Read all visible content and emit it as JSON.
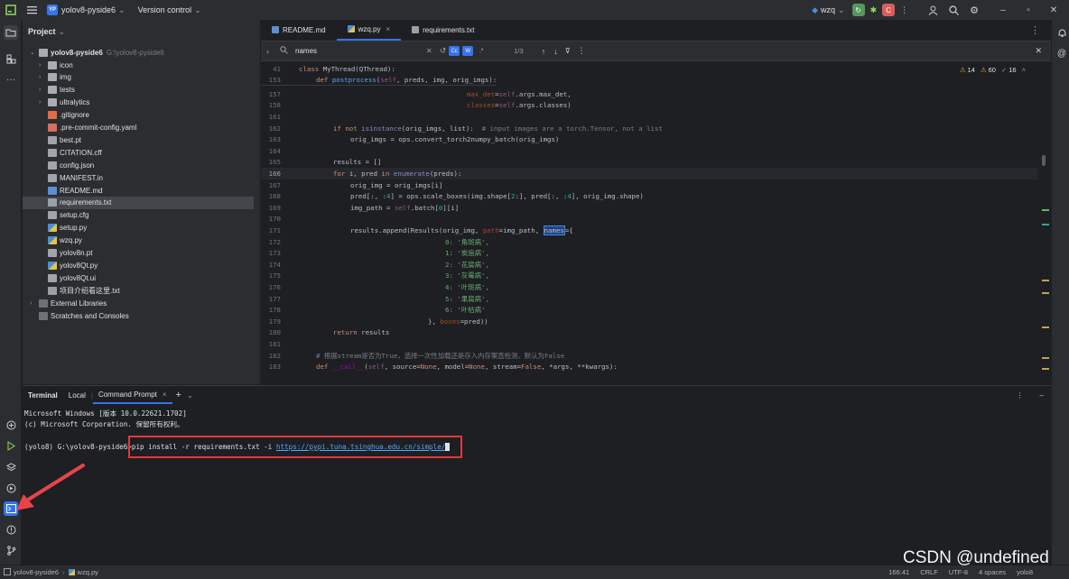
{
  "titlebar": {
    "project_badge": "YP",
    "project_name": "yolov8-pyside6",
    "vcs_label": "Version control",
    "run_config": "wzq",
    "colors": {
      "accent": "#3574f0",
      "run_green": "#57965c",
      "stop_red": "#db5c5c"
    }
  },
  "project_panel": {
    "title": "Project",
    "root_name": "yolov8-pyside6",
    "root_path": "G:\\yolov8-pyside6",
    "items": [
      {
        "label": "icon",
        "kind": "folder"
      },
      {
        "label": "img",
        "kind": "folder"
      },
      {
        "label": "tests",
        "kind": "folder"
      },
      {
        "label": "ultralytics",
        "kind": "folder"
      },
      {
        "label": ".gitignore",
        "kind": "git"
      },
      {
        "label": ".pre-commit-config.yaml",
        "kind": "yaml"
      },
      {
        "label": "best.pt",
        "kind": "file"
      },
      {
        "label": "CITATION.cff",
        "kind": "file"
      },
      {
        "label": "config.json",
        "kind": "file"
      },
      {
        "label": "MANIFEST.in",
        "kind": "file"
      },
      {
        "label": "README.md",
        "kind": "md"
      },
      {
        "label": "requirements.txt",
        "kind": "txt"
      },
      {
        "label": "setup.cfg",
        "kind": "file"
      },
      {
        "label": "setup.py",
        "kind": "py"
      },
      {
        "label": "wzq.py",
        "kind": "py"
      },
      {
        "label": "yolov8n.pt",
        "kind": "file"
      },
      {
        "label": "yolov8Qt.py",
        "kind": "py"
      },
      {
        "label": "yolov8Qt.ui",
        "kind": "file"
      },
      {
        "label": "项目介绍看这里.txt",
        "kind": "txt"
      }
    ],
    "external_libraries": "External Libraries",
    "scratches": "Scratches and Consoles"
  },
  "editor": {
    "tabs": [
      "README.md",
      "wzq.py",
      "requirements.txt"
    ],
    "active_tab": "wzq.py",
    "find": {
      "query": "names",
      "match_count": "1/3",
      "case_label": "Cc",
      "word_label": "W",
      "regex_label": ".*"
    },
    "inspections": {
      "warnings": "14",
      "weak_warnings": "60",
      "typos": "16"
    },
    "breadcrumb_class": "class MyThread(QThread):",
    "breadcrumb_def": "def postprocess(self, preds, img, orig_imgs):",
    "lines": [
      {
        "n": "41",
        "text": "class MyThread(QThread):"
      },
      {
        "n": "153",
        "text": "def postprocess(self, preds, img, orig_imgs):"
      },
      {
        "n": "157",
        "text": "max_det=self.args.max_det,"
      },
      {
        "n": "158",
        "text": "classes=self.args.classes)"
      },
      {
        "n": "161",
        "text": ""
      },
      {
        "n": "162",
        "text": "if not isinstance(orig_imgs, list):",
        "comment": "# input images are a torch.Tensor, not a list"
      },
      {
        "n": "163",
        "text": "orig_imgs = ops.convert_torch2numpy_batch(orig_imgs)"
      },
      {
        "n": "164",
        "text": ""
      },
      {
        "n": "165",
        "text": "results = []"
      },
      {
        "n": "166",
        "text": "for i, pred in enumerate(preds):"
      },
      {
        "n": "167",
        "text": "orig_img = orig_imgs[i]"
      },
      {
        "n": "168",
        "text": "pred[:, :4] = ops.scale_boxes(img.shape[2:], pred[:, :4], orig_img.shape)"
      },
      {
        "n": "169",
        "text": "img_path = self.batch[0][i]"
      },
      {
        "n": "170",
        "text": ""
      },
      {
        "n": "171",
        "text": "results.append(Results(orig_img, path=img_path, names={"
      },
      {
        "n": "172",
        "text": "0: '角斑病',"
      },
      {
        "n": "173",
        "text": "1: '炭疽病',"
      },
      {
        "n": "174",
        "text": "2: '花腐病',"
      },
      {
        "n": "175",
        "text": "3: '灰霉病',"
      },
      {
        "n": "176",
        "text": "4: '叶斑病',"
      },
      {
        "n": "177",
        "text": "5: '果腐病',"
      },
      {
        "n": "178",
        "text": "6: '叶枯病'"
      },
      {
        "n": "179",
        "text": "}, boxes=pred))"
      },
      {
        "n": "180",
        "text": "return results"
      },
      {
        "n": "181",
        "text": ""
      },
      {
        "n": "182",
        "text": "# 根据stream是否为True，选择一次性加载还是存入内存案直检测，默认为False"
      },
      {
        "n": "183",
        "text": "def __call__(self, source=None, model=None, stream=False, *args, **kwargs):"
      }
    ]
  },
  "terminal": {
    "title": "Terminal",
    "tabs": [
      "Local",
      "Command Prompt"
    ],
    "active_tab": "Command Prompt",
    "lines": [
      "Microsoft Windows [版本 10.0.22621.1702]",
      "(c) Microsoft Corporation. 保留所有权利。"
    ],
    "prompt": "(yolo8) G:\\yolov8-pyside6>",
    "command": "pip install -r requirements.txt -i ",
    "command_url": "https://pypi.tuna.tsinghua.edu.cn/simple/",
    "highlight_color": "#e03a3a"
  },
  "statusbar": {
    "breadcrumb_project": "yolov8-pyside6",
    "breadcrumb_file": "wzq.py",
    "position": "166:41",
    "line_sep": "CRLF",
    "encoding": "UTF-8",
    "indent": "4 spaces",
    "interpreter": "yolo8"
  },
  "watermark": "CSDN @undefined"
}
